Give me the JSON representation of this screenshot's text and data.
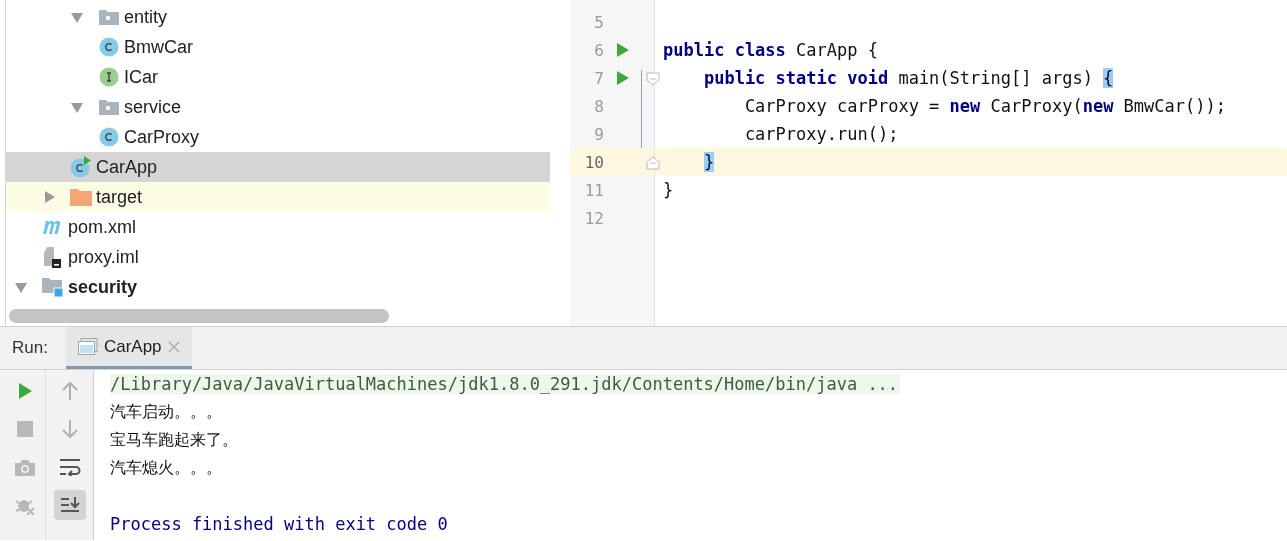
{
  "project_tree": {
    "items": [
      {
        "children": [
          {
            "children": [
              {
                "label": "entity",
                "kind": "package",
                "expanded": true,
                "selected": false,
                "children": [
                  {
                    "label": "BmwCar",
                    "kind": "class",
                    "selected": false
                  },
                  {
                    "label": "ICar",
                    "kind": "interface",
                    "selected": false
                  }
                ]
              },
              {
                "label": "service",
                "kind": "package",
                "expanded": true,
                "selected": false,
                "children": [
                  {
                    "label": "CarProxy",
                    "kind": "class",
                    "selected": false
                  }
                ]
              },
              {
                "label": "CarApp",
                "kind": "main_class",
                "selected": true
              }
            ]
          },
          {
            "label": "target",
            "kind": "excluded_folder",
            "expanded": false,
            "highlighted": true,
            "selected": false
          },
          {
            "label": "pom.xml",
            "kind": "maven",
            "selected": false
          },
          {
            "label": "proxy.iml",
            "kind": "iml",
            "selected": false
          }
        ]
      },
      {
        "label": "security",
        "kind": "module",
        "expanded": true,
        "selected": false
      }
    ]
  },
  "editor": {
    "lines": [
      {
        "number": "5"
      },
      {
        "number": "6",
        "runnable": true,
        "tokens": [
          {
            "kind": "keyword",
            "text": "public class"
          },
          {
            "kind": "plain",
            "text": " CarApp {"
          }
        ]
      },
      {
        "number": "7",
        "runnable": true,
        "fold_start": true,
        "tokens": [
          {
            "kind": "keyword",
            "text": "    public static void"
          },
          {
            "kind": "plain",
            "text": " main(String[] args) "
          },
          {
            "kind": "brace_match",
            "text": "{"
          }
        ]
      },
      {
        "number": "8",
        "tokens": [
          {
            "kind": "plain",
            "text": "        CarProxy carProxy = "
          },
          {
            "kind": "keyword",
            "text": "new"
          },
          {
            "kind": "plain",
            "text": " CarProxy("
          },
          {
            "kind": "keyword",
            "text": "new"
          },
          {
            "kind": "plain",
            "text": " BmwCar());"
          }
        ]
      },
      {
        "number": "9",
        "tokens": [
          {
            "kind": "plain",
            "text": "        carProxy.run();"
          }
        ]
      },
      {
        "number": "10",
        "fold_end": true,
        "current": true,
        "tokens": [
          {
            "kind": "brace_match",
            "text": "    }"
          }
        ]
      },
      {
        "number": "11",
        "tokens": [
          {
            "kind": "plain",
            "text": "}"
          }
        ]
      },
      {
        "number": "12"
      }
    ]
  },
  "run_panel": {
    "label": "Run:",
    "tabs": [
      {
        "label": "CarApp",
        "selected": true
      }
    ],
    "left_toolbar": [
      {
        "kind": "run",
        "disabled": false
      },
      {
        "kind": "stop",
        "disabled": true
      },
      {
        "kind": "camera",
        "disabled": true
      },
      {
        "kind": "debug",
        "disabled": true
      }
    ],
    "console_toolbar": [
      {
        "kind": "up",
        "toggled": false
      },
      {
        "kind": "down",
        "toggled": false
      },
      {
        "kind": "wrap",
        "toggled": false
      },
      {
        "kind": "scroll_end",
        "toggled": true
      }
    ],
    "console": [
      {
        "kind": "command",
        "text": "/Library/Java/JavaVirtualMachines/jdk1.8.0_291.jdk/Contents/Home/bin/java ..."
      },
      {
        "kind": "output",
        "text": "汽车启动。。。"
      },
      {
        "kind": "output",
        "text": "宝马车跑起来了。"
      },
      {
        "kind": "output",
        "text": "汽车熄火。。。"
      },
      {
        "kind": "exit",
        "text": "Process finished with exit code 0"
      }
    ]
  }
}
